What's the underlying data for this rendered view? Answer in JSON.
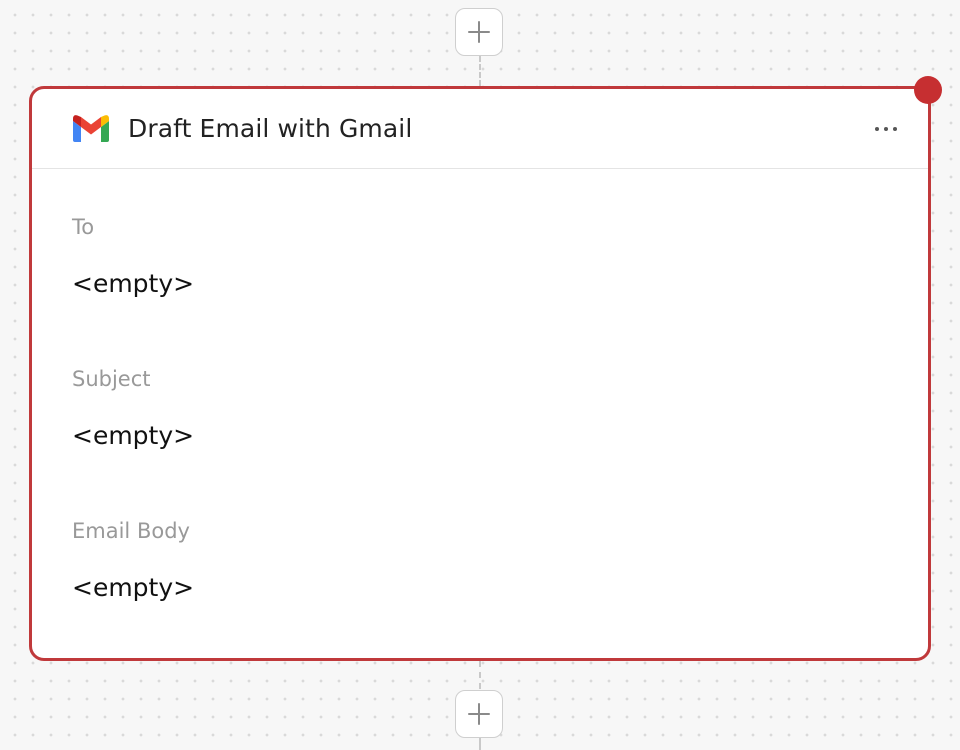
{
  "node": {
    "title": "Draft Email with Gmail",
    "icon": "gmail-icon",
    "menu_icon": "more-horizontal-icon",
    "status_color": "#c62f31",
    "border_color": "#c0393b",
    "fields": [
      {
        "label": "To",
        "value": "<empty>"
      },
      {
        "label": "Subject",
        "value": "<empty>"
      },
      {
        "label": "Email Body",
        "value": "<empty>"
      }
    ]
  },
  "add_buttons": {
    "icon": "plus-icon"
  }
}
